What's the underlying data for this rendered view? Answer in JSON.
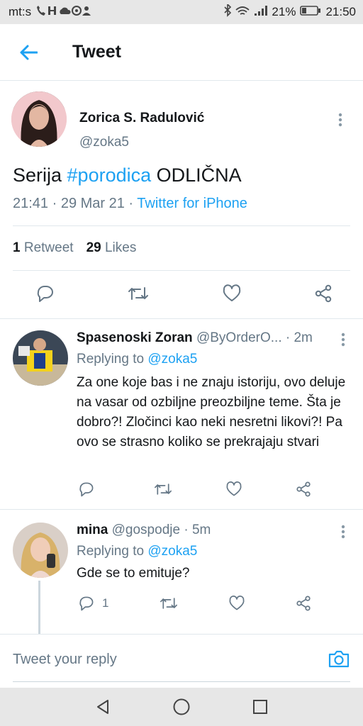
{
  "status_bar": {
    "carrier": "mt:s",
    "battery": "21%",
    "time": "21:50"
  },
  "app_bar": {
    "title": "Tweet"
  },
  "main_tweet": {
    "author_name": "Zorica S. Radulović",
    "author_handle": "@zoka5",
    "text_before": "Serija ",
    "hashtag": "#porodica",
    "text_after": " ODLIČNA",
    "time_date": "21:41 · 29 Mar 21 · ",
    "source": "Twitter for iPhone",
    "retweets_count": "1",
    "retweets_label": "Retweet",
    "likes_count": "29",
    "likes_label": "Likes"
  },
  "replies": [
    {
      "author_name": "Spasenoski Zoran",
      "author_handle": "@ByOrderO...",
      "time": " · 2m",
      "replying_prefix": "Replying to ",
      "replying_to": "@zoka5",
      "text": "Za one koje bas i ne znaju istoriju, ovo deluje na vasar od ozbiljne preozbiljne teme. Šta je dobro?! Zločinci kao neki nesretni likovi?! Pa ovo se strasno koliko se prekrajaju stvari",
      "reply_count": ""
    },
    {
      "author_name": "mina",
      "author_handle": "@gospodje",
      "time": " · 5m",
      "replying_prefix": "Replying to ",
      "replying_to": "@zoka5",
      "text": "Gde se to emituje?",
      "reply_count": "1"
    }
  ],
  "composer": {
    "placeholder": "Tweet your reply"
  },
  "colors": {
    "accent": "#1da1f2",
    "secondary_text": "#657786",
    "divider": "#e1e8ed"
  },
  "icons": [
    "back-arrow-icon",
    "more-icon",
    "reply-icon",
    "retweet-icon",
    "like-icon",
    "share-icon",
    "camera-icon",
    "nav-back-icon",
    "nav-home-icon",
    "nav-recents-icon"
  ]
}
